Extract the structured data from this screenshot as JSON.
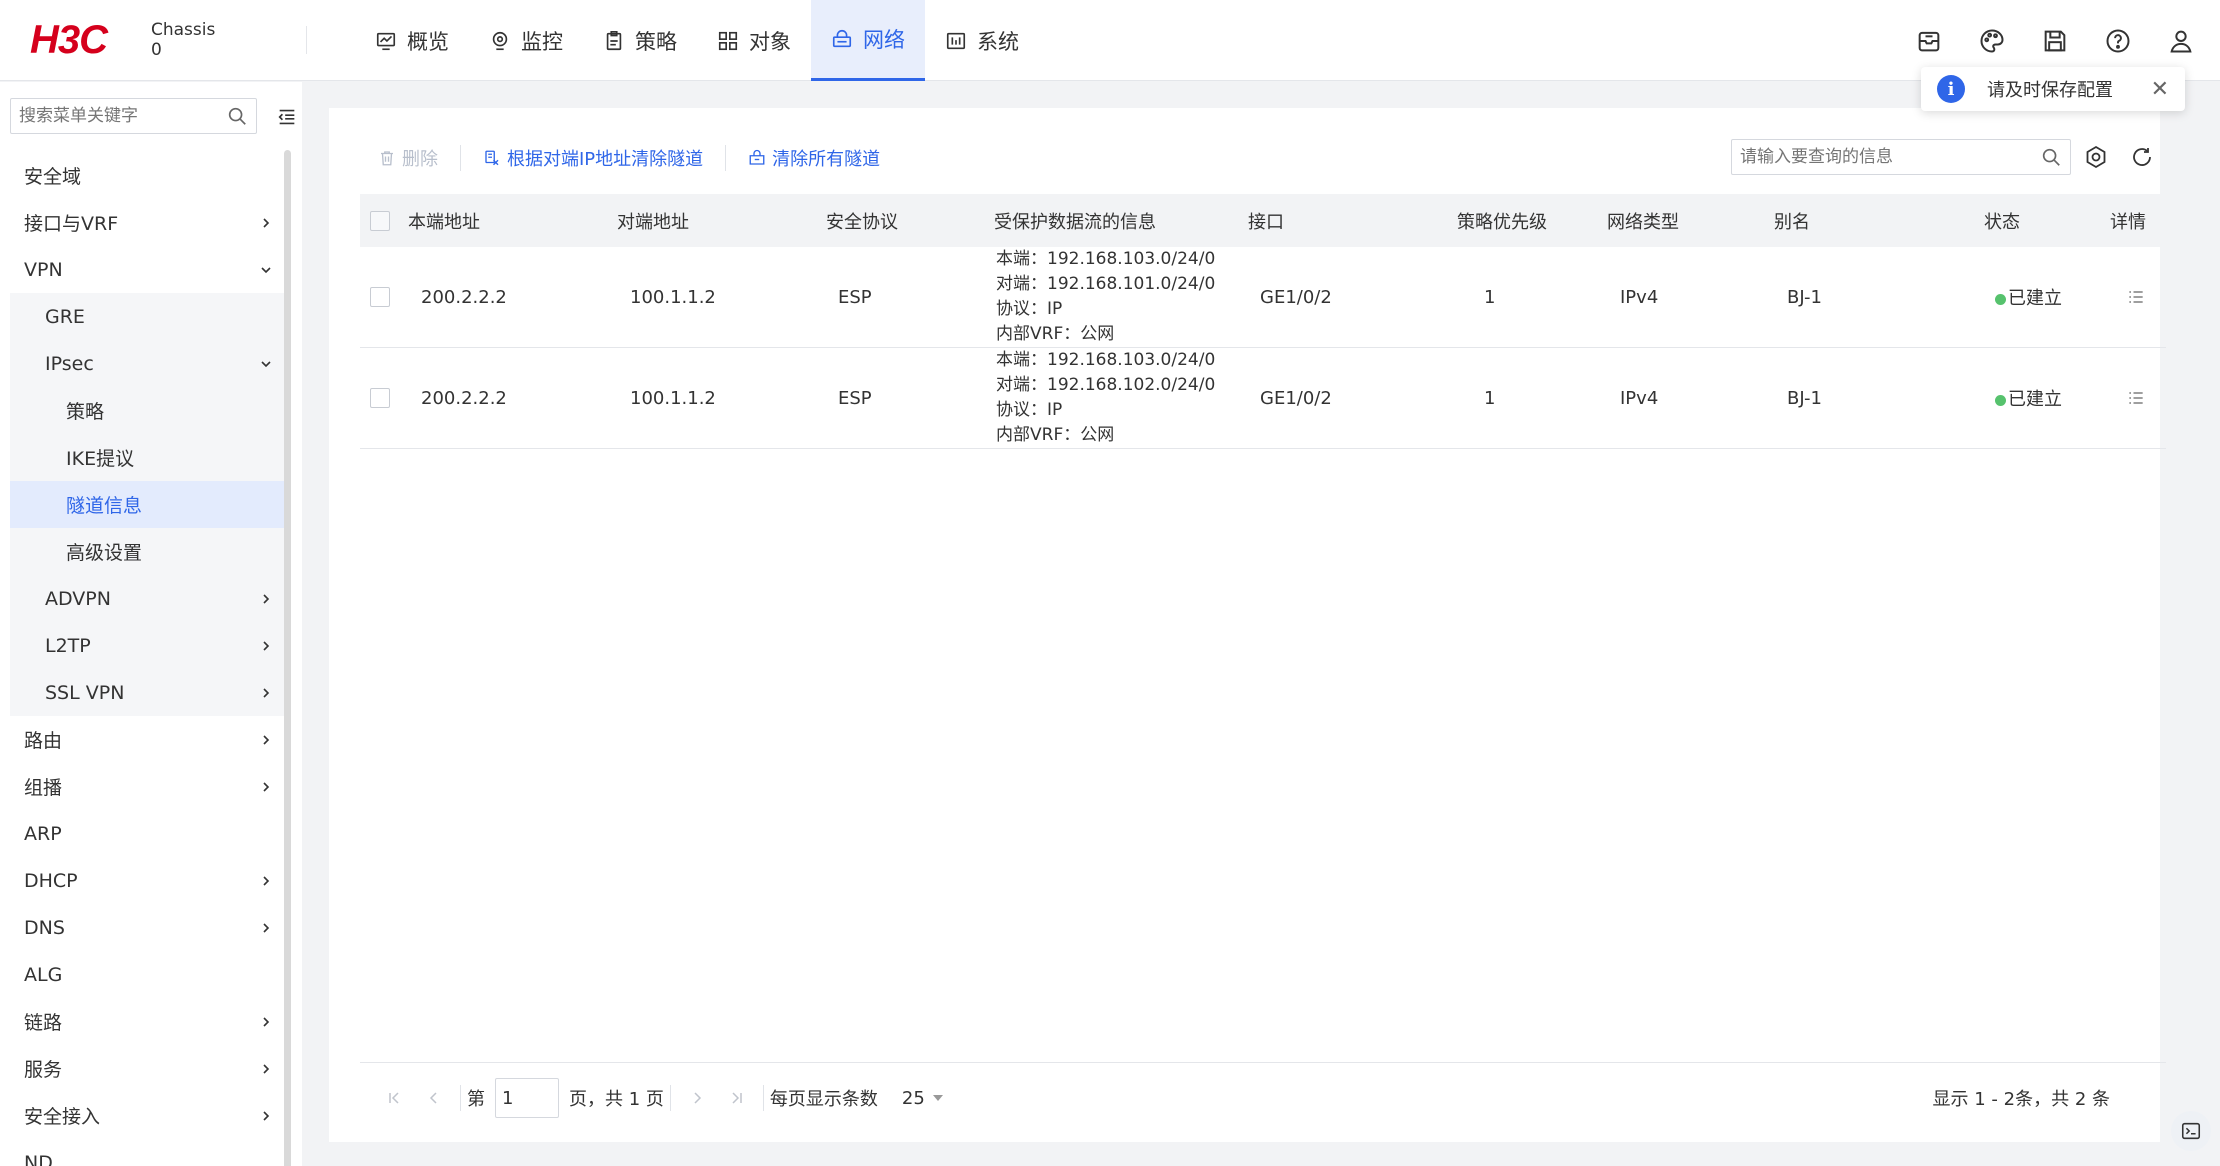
{
  "brand": {
    "logo": "H3C",
    "chassis_line1": "Chassis",
    "chassis_line2": "0"
  },
  "nav": [
    {
      "label": "概览",
      "icon": "dashboard-icon"
    },
    {
      "label": "监控",
      "icon": "monitor-icon"
    },
    {
      "label": "策略",
      "icon": "policy-icon"
    },
    {
      "label": "对象",
      "icon": "objects-icon"
    },
    {
      "label": "网络",
      "icon": "network-icon",
      "active": true
    },
    {
      "label": "系统",
      "icon": "system-icon"
    }
  ],
  "header_icons": [
    "message-icon",
    "palette-icon",
    "save-icon",
    "help-icon",
    "user-icon"
  ],
  "toast": {
    "message": "请及时保存配置"
  },
  "sidebar": {
    "search_placeholder": "搜索菜单关键字",
    "items": [
      {
        "label": "安全域",
        "level": 1,
        "expandable": false
      },
      {
        "label": "接口与VRF",
        "level": 1,
        "expandable": true,
        "expanded": false
      },
      {
        "label": "VPN",
        "level": 1,
        "expandable": true,
        "expanded": true
      },
      {
        "label": "GRE",
        "level": 2,
        "expandable": false
      },
      {
        "label": "IPsec",
        "level": 2,
        "expandable": true,
        "expanded": true
      },
      {
        "label": "策略",
        "level": 3,
        "expandable": false
      },
      {
        "label": "IKE提议",
        "level": 3,
        "expandable": false
      },
      {
        "label": "隧道信息",
        "level": 3,
        "expandable": false,
        "selected": true
      },
      {
        "label": "高级设置",
        "level": 3,
        "expandable": false
      },
      {
        "label": "ADVPN",
        "level": 2,
        "expandable": true,
        "expanded": false
      },
      {
        "label": "L2TP",
        "level": 2,
        "expandable": true,
        "expanded": false
      },
      {
        "label": "SSL VPN",
        "level": 2,
        "expandable": true,
        "expanded": false
      },
      {
        "label": "路由",
        "level": 1,
        "expandable": true,
        "expanded": false
      },
      {
        "label": "组播",
        "level": 1,
        "expandable": true,
        "expanded": false
      },
      {
        "label": "ARP",
        "level": 1,
        "expandable": false
      },
      {
        "label": "DHCP",
        "level": 1,
        "expandable": true,
        "expanded": false
      },
      {
        "label": "DNS",
        "level": 1,
        "expandable": true,
        "expanded": false
      },
      {
        "label": "ALG",
        "level": 1,
        "expandable": false
      },
      {
        "label": "链路",
        "level": 1,
        "expandable": true,
        "expanded": false
      },
      {
        "label": "服务",
        "level": 1,
        "expandable": true,
        "expanded": false
      },
      {
        "label": "安全接入",
        "level": 1,
        "expandable": true,
        "expanded": false
      },
      {
        "label": "ND",
        "level": 1,
        "expandable": false
      }
    ]
  },
  "toolbar": {
    "delete_label": "删除",
    "clear_by_peer_label": "根据对端IP地址清除隧道",
    "clear_all_label": "清除所有隧道",
    "query_placeholder": "请输入要查询的信息"
  },
  "table": {
    "columns": [
      "本端地址",
      "对端地址",
      "安全协议",
      "受保护数据流的信息",
      "接口",
      "策略优先级",
      "网络类型",
      "别名",
      "状态",
      "详情"
    ],
    "rows": [
      {
        "local": "200.2.2.2",
        "peer": "100.1.1.2",
        "protocol": "ESP",
        "flow": [
          "本端：192.168.103.0/24/0",
          "对端：192.168.101.0/24/0",
          "协议：IP",
          "内部VRF：公网"
        ],
        "interface": "GE1/0/2",
        "priority": "1",
        "net_type": "IPv4",
        "alias": "BJ-1",
        "status": "已建立",
        "status_color": "#56c26d"
      },
      {
        "local": "200.2.2.2",
        "peer": "100.1.1.2",
        "protocol": "ESP",
        "flow": [
          "本端：192.168.103.0/24/0",
          "对端：192.168.102.0/24/0",
          "协议：IP",
          "内部VRF：公网"
        ],
        "interface": "GE1/0/2",
        "priority": "1",
        "net_type": "IPv4",
        "alias": "BJ-1",
        "status": "已建立",
        "status_color": "#56c26d"
      }
    ]
  },
  "pagination": {
    "page_prefix": "第",
    "current_page": "1",
    "page_suffix": "页，共 1 页",
    "page_size_label": "每页显示条数",
    "page_size": "25",
    "summary": "显示 1 - 2条，共 2 条"
  },
  "colors": {
    "accent": "#2f66e8",
    "brand_red": "#d5001c",
    "status_ok": "#56c26d"
  }
}
